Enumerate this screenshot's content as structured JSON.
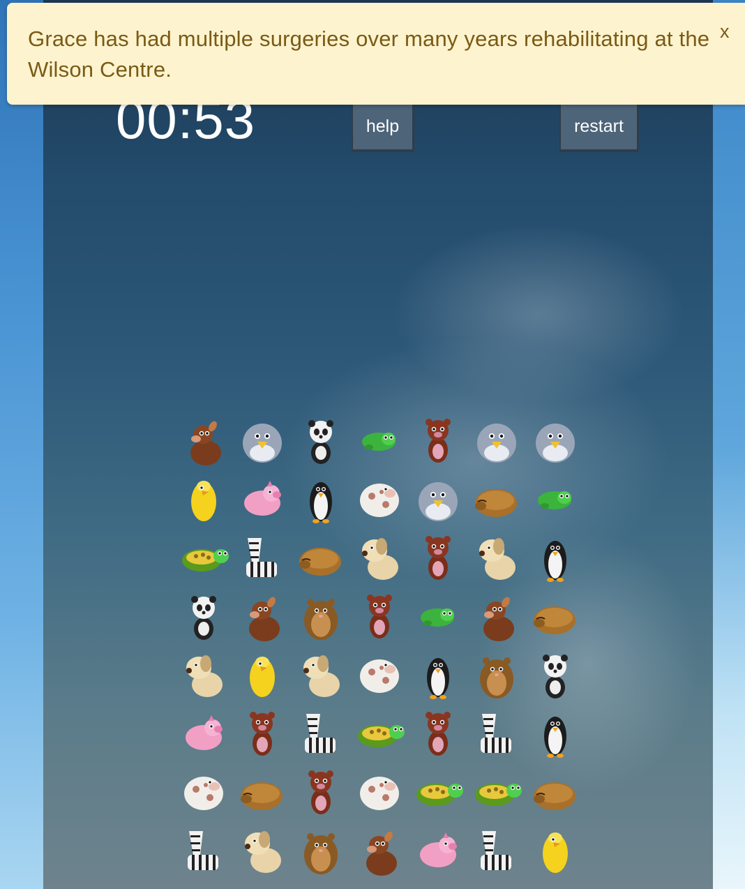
{
  "banner": {
    "message": "Grace has had multiple surgeries over many years rehabilitating at the Wilson Centre.",
    "close_label": "x"
  },
  "timer": "00:53",
  "buttons": {
    "help": "help",
    "restart": "restart"
  },
  "board": {
    "rows": [
      [
        "dog-brown",
        "bird-blue",
        "panda",
        "turtle-green-small",
        "bear",
        "bird-blue",
        "bird-blue"
      ],
      [
        "chick",
        "pig",
        "penguin",
        "cow",
        "bird-blue",
        "bear-sleeping",
        "turtle-green-small"
      ],
      [
        "turtle",
        "zebra",
        "bear-sleeping",
        "puppy",
        "bear",
        "puppy",
        "penguin"
      ],
      [
        "panda",
        "dog-brown",
        "hamster",
        "bear",
        "turtle-green-small",
        "dog-brown",
        "bear-sleeping"
      ],
      [
        "puppy",
        "chick",
        "puppy",
        "cow",
        "penguin",
        "hamster",
        "panda"
      ],
      [
        "pig",
        "bear",
        "zebra",
        "turtle",
        "bear",
        "zebra",
        "penguin"
      ],
      [
        "cow",
        "bear-sleeping",
        "bear",
        "cow",
        "turtle",
        "turtle",
        "bear-sleeping"
      ],
      [
        "zebra",
        "puppy",
        "hamster",
        "dog-brown",
        "pig",
        "zebra",
        "chick"
      ]
    ]
  },
  "colors": {
    "banner_bg": "#fdf3cf",
    "banner_text": "#7a5a14",
    "button_bg": "#4d6479",
    "timer_text": "#ffffff"
  }
}
